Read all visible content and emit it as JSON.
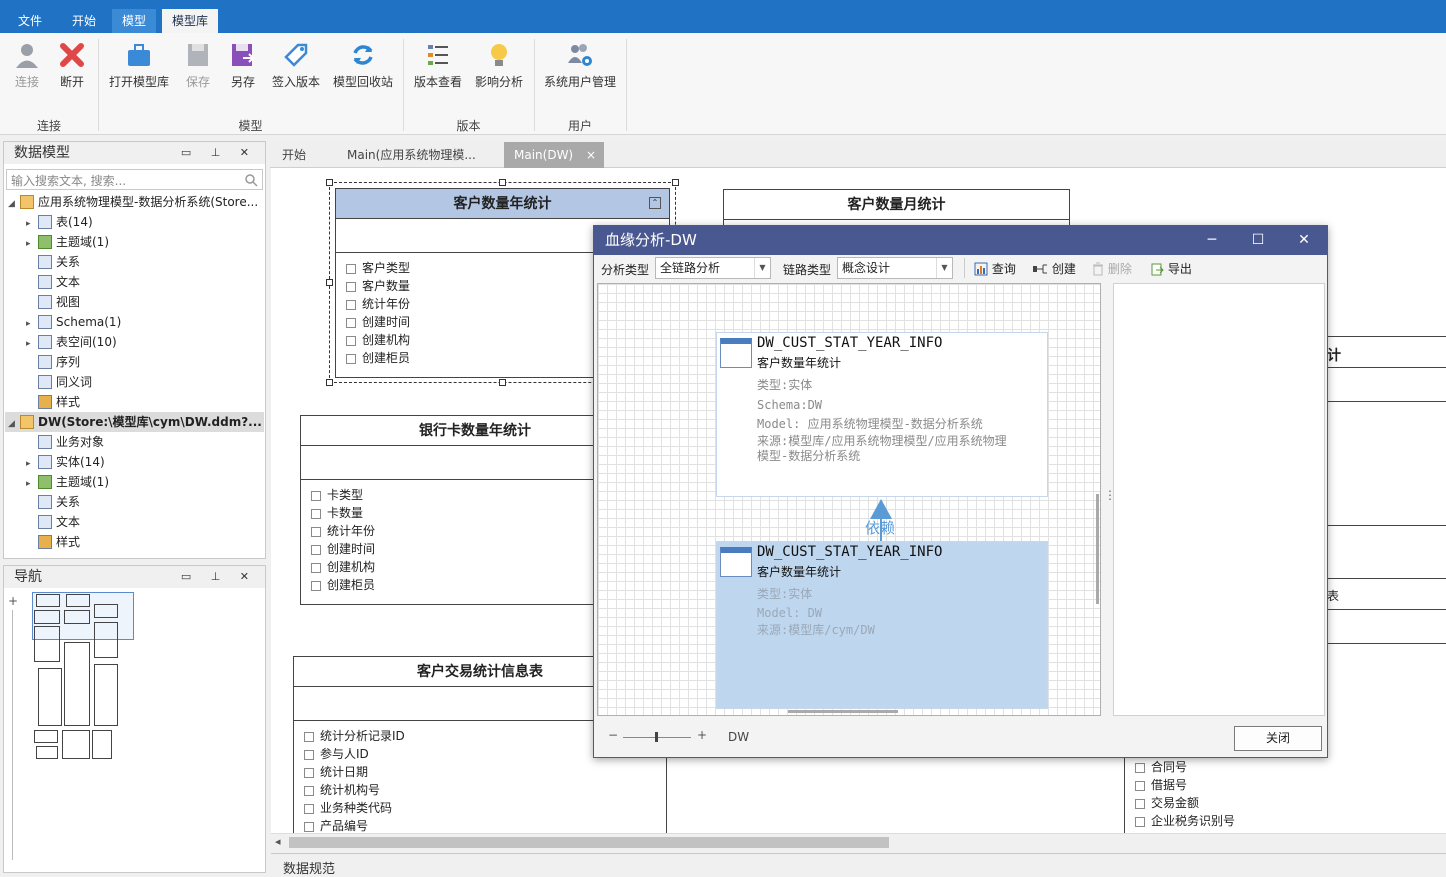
{
  "menu": {
    "tabs": [
      "文件",
      "开始",
      "模型",
      "模型库"
    ],
    "active_index": 3
  },
  "ribbon": {
    "buttons": {
      "connect": "连接",
      "disconnect": "断开",
      "open_lib": "打开模型库",
      "save": "保存",
      "save_as": "另存",
      "checkin": "签入版本",
      "recycle": "模型回收站",
      "version_view": "版本查看",
      "impact": "影响分析",
      "user_mgmt": "系统用户管理"
    },
    "groups": {
      "connect": "连接",
      "model": "模型",
      "version": "版本",
      "user": "用户"
    }
  },
  "data_model_panel": {
    "title": "数据模型",
    "search_placeholder": "输入搜索文本, 搜索...",
    "tree": [
      "应用系统物理模型-数据分析系统(Store...",
      "表(14)",
      "主题域(1)",
      "关系",
      "文本",
      "视图",
      "Schema(1)",
      "表空间(10)",
      "序列",
      "同义词",
      "样式",
      "DW(Store:\\模型库\\cym\\DW.ddm?...",
      "业务对象",
      "实体(14)",
      "主题域(1)",
      "关系",
      "文本",
      "样式"
    ]
  },
  "nav_panel": {
    "title": "导航",
    "plus": "+"
  },
  "doc_tabs": [
    "开始",
    "Main(应用系统物理模...",
    "Main(DW)"
  ],
  "doc_tab_close": "×",
  "entities": {
    "e1": {
      "title": "客户数量年统计",
      "fields": [
        "客户类型",
        "客户数量",
        "统计年份",
        "创建时间",
        "创建机构",
        "创建柜员"
      ]
    },
    "e2": {
      "title": "客户数量月统计"
    },
    "e3": {
      "title": "银行卡数量年统计",
      "fields": [
        "卡类型",
        "卡数量",
        "统计年份",
        "创建时间",
        "创建机构",
        "创建柜员"
      ]
    },
    "e4": {
      "title": "客户交易统计信息表",
      "fields": [
        "统计分析记录ID",
        "参与人ID",
        "统计日期",
        "统计机构号",
        "业务种类代码",
        "产品编号"
      ]
    },
    "e5": {
      "fields": [
        "合同号",
        "借据号",
        "交易金额",
        "企业税务识别号"
      ]
    },
    "partial_a": "计",
    "partial_b": "表"
  },
  "dialog": {
    "title": "血缘分析-DW",
    "analysis_type_label": "分析类型",
    "analysis_type_value": "全链路分析",
    "link_type_label": "链路类型",
    "link_type_value": "概念设计",
    "toolbar": {
      "query": "查询",
      "create": "创建",
      "delete": "删除",
      "export": "导出"
    },
    "node1": {
      "name": "DW_CUST_STAT_YEAR_INFO",
      "cn": "客户数量年统计",
      "props": [
        "类型:实体",
        "Schema:DW",
        "Model: 应用系统物理模型-数据分析系统",
        "来源:模型库/应用系统物理模型/应用系统物理",
        "模型-数据分析系统"
      ]
    },
    "edge_label": "依赖",
    "node2": {
      "name": "DW_CUST_STAT_YEAR_INFO",
      "cn": "客户数量年统计",
      "props": [
        "类型:实体",
        "Model: DW",
        "来源:模型库/cym/DW"
      ]
    },
    "zoom_minus": "−",
    "zoom_plus": "+",
    "footer_model": "DW",
    "close": "关闭",
    "win_min": "─",
    "win_max": "☐",
    "win_close": "✕"
  },
  "bottom_panel": {
    "title": "数据规范"
  },
  "colors": {
    "menubar": "#1f72c4",
    "dialog_title": "#4a5891",
    "selected_node": "#bed6ee",
    "edge": "#5b9bd5"
  }
}
